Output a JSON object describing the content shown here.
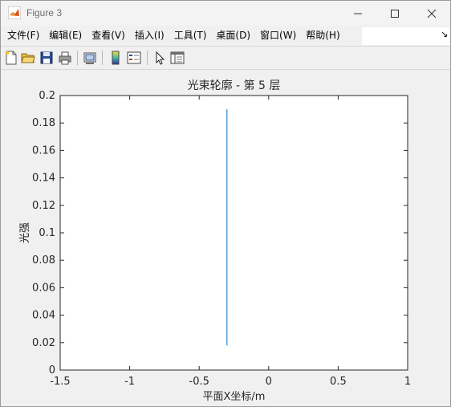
{
  "window": {
    "title": "Figure 3",
    "accent_color": "#0072BD"
  },
  "menu": {
    "items": [
      {
        "id": "file",
        "label": "文件(F)"
      },
      {
        "id": "edit",
        "label": "编辑(E)"
      },
      {
        "id": "view",
        "label": "查看(V)"
      },
      {
        "id": "insert",
        "label": "插入(I)"
      },
      {
        "id": "tools",
        "label": "工具(T)"
      },
      {
        "id": "desktop",
        "label": "桌面(D)"
      },
      {
        "id": "window",
        "label": "窗口(W)"
      },
      {
        "id": "help",
        "label": "帮助(H)"
      }
    ],
    "overflow_arrow": "↘"
  },
  "toolbar": {
    "icons": [
      "new-figure-icon",
      "open-file-icon",
      "save-icon",
      "print-icon",
      "link-plot-icon",
      "insert-colorbar-icon",
      "insert-legend-icon",
      "edit-plot-arrow-icon",
      "property-inspector-icon"
    ]
  },
  "chart_data": {
    "type": "line",
    "title": "光束轮廓 - 第 5 层",
    "xlabel": "平面X坐标/m",
    "ylabel": "光强",
    "xlim": [
      -1.5,
      1
    ],
    "ylim": [
      0,
      0.2
    ],
    "xticks": [
      -1.5,
      -1,
      -0.5,
      0,
      0.5,
      1
    ],
    "xtick_labels": [
      "-1.5",
      "-1",
      "-0.5",
      "0",
      "0.5",
      "1"
    ],
    "yticks": [
      0,
      0.02,
      0.04,
      0.06,
      0.08,
      0.1,
      0.12,
      0.14,
      0.16,
      0.18,
      0.2
    ],
    "ytick_labels": [
      "0",
      "0.02",
      "0.04",
      "0.06",
      "0.08",
      "0.1",
      "0.12",
      "0.14",
      "0.16",
      "0.18",
      "0.2"
    ],
    "grid": false,
    "series": [
      {
        "color": "#0072BD",
        "x": [
          -0.3,
          -0.3
        ],
        "y": [
          0.018,
          0.19
        ]
      }
    ]
  }
}
